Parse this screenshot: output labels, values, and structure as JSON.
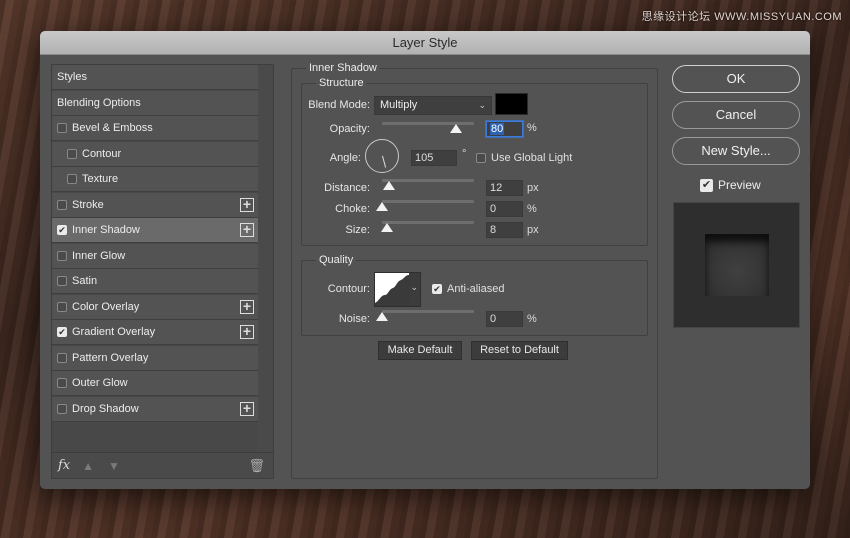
{
  "watermark": "思缘设计论坛 WWW.MISSYUAN.COM",
  "dialog": {
    "title": "Layer Style"
  },
  "style_list": {
    "items": [
      {
        "label": "Styles",
        "has_checkbox": false,
        "checked": false,
        "has_add": false,
        "indent": false,
        "selected": false
      },
      {
        "label": "Blending Options",
        "has_checkbox": false,
        "checked": false,
        "has_add": false,
        "indent": false,
        "selected": false
      },
      {
        "label": "Bevel & Emboss",
        "has_checkbox": true,
        "checked": false,
        "has_add": false,
        "indent": false,
        "selected": false
      },
      {
        "label": "Contour",
        "has_checkbox": true,
        "checked": false,
        "has_add": false,
        "indent": true,
        "selected": false
      },
      {
        "label": "Texture",
        "has_checkbox": true,
        "checked": false,
        "has_add": false,
        "indent": true,
        "selected": false
      },
      {
        "label": "Stroke",
        "has_checkbox": true,
        "checked": false,
        "has_add": true,
        "indent": false,
        "selected": false
      },
      {
        "label": "Inner Shadow",
        "has_checkbox": true,
        "checked": true,
        "has_add": true,
        "indent": false,
        "selected": true
      },
      {
        "label": "Inner Glow",
        "has_checkbox": true,
        "checked": false,
        "has_add": false,
        "indent": false,
        "selected": false
      },
      {
        "label": "Satin",
        "has_checkbox": true,
        "checked": false,
        "has_add": false,
        "indent": false,
        "selected": false
      },
      {
        "label": "Color Overlay",
        "has_checkbox": true,
        "checked": false,
        "has_add": true,
        "indent": false,
        "selected": false
      },
      {
        "label": "Gradient Overlay",
        "has_checkbox": true,
        "checked": true,
        "has_add": true,
        "indent": false,
        "selected": false
      },
      {
        "label": "Pattern Overlay",
        "has_checkbox": true,
        "checked": false,
        "has_add": false,
        "indent": false,
        "selected": false
      },
      {
        "label": "Outer Glow",
        "has_checkbox": true,
        "checked": false,
        "has_add": false,
        "indent": false,
        "selected": false
      },
      {
        "label": "Drop Shadow",
        "has_checkbox": true,
        "checked": false,
        "has_add": true,
        "indent": false,
        "selected": false
      }
    ],
    "footer": {
      "fx_label": "fx",
      "up_icon": "▲",
      "down_icon": "▼",
      "trash_icon": "🗑"
    }
  },
  "inner_shadow": {
    "section_title": "Inner Shadow",
    "structure": {
      "title": "Structure",
      "blend_mode_label": "Blend Mode:",
      "blend_mode_value": "Multiply",
      "shadow_color": "#000000",
      "opacity_label": "Opacity:",
      "opacity_value": "80",
      "opacity_unit": "%",
      "opacity_fraction": 0.8,
      "angle_label": "Angle:",
      "angle_value": "105",
      "angle_unit": "°",
      "use_global_light_label": "Use Global Light",
      "use_global_light_checked": false,
      "distance_label": "Distance:",
      "distance_value": "12",
      "distance_unit": "px",
      "distance_fraction": 0.08,
      "choke_label": "Choke:",
      "choke_value": "0",
      "choke_unit": "%",
      "choke_fraction": 0.0,
      "size_label": "Size:",
      "size_value": "8",
      "size_unit": "px",
      "size_fraction": 0.05
    },
    "quality": {
      "title": "Quality",
      "contour_label": "Contour:",
      "anti_aliased_label": "Anti-aliased",
      "anti_aliased_checked": true,
      "noise_label": "Noise:",
      "noise_value": "0",
      "noise_unit": "%",
      "noise_fraction": 0.0
    },
    "make_default_label": "Make Default",
    "reset_default_label": "Reset to Default"
  },
  "actions": {
    "ok_label": "OK",
    "cancel_label": "Cancel",
    "new_style_label": "New Style...",
    "preview_label": "Preview",
    "preview_checked": true
  }
}
